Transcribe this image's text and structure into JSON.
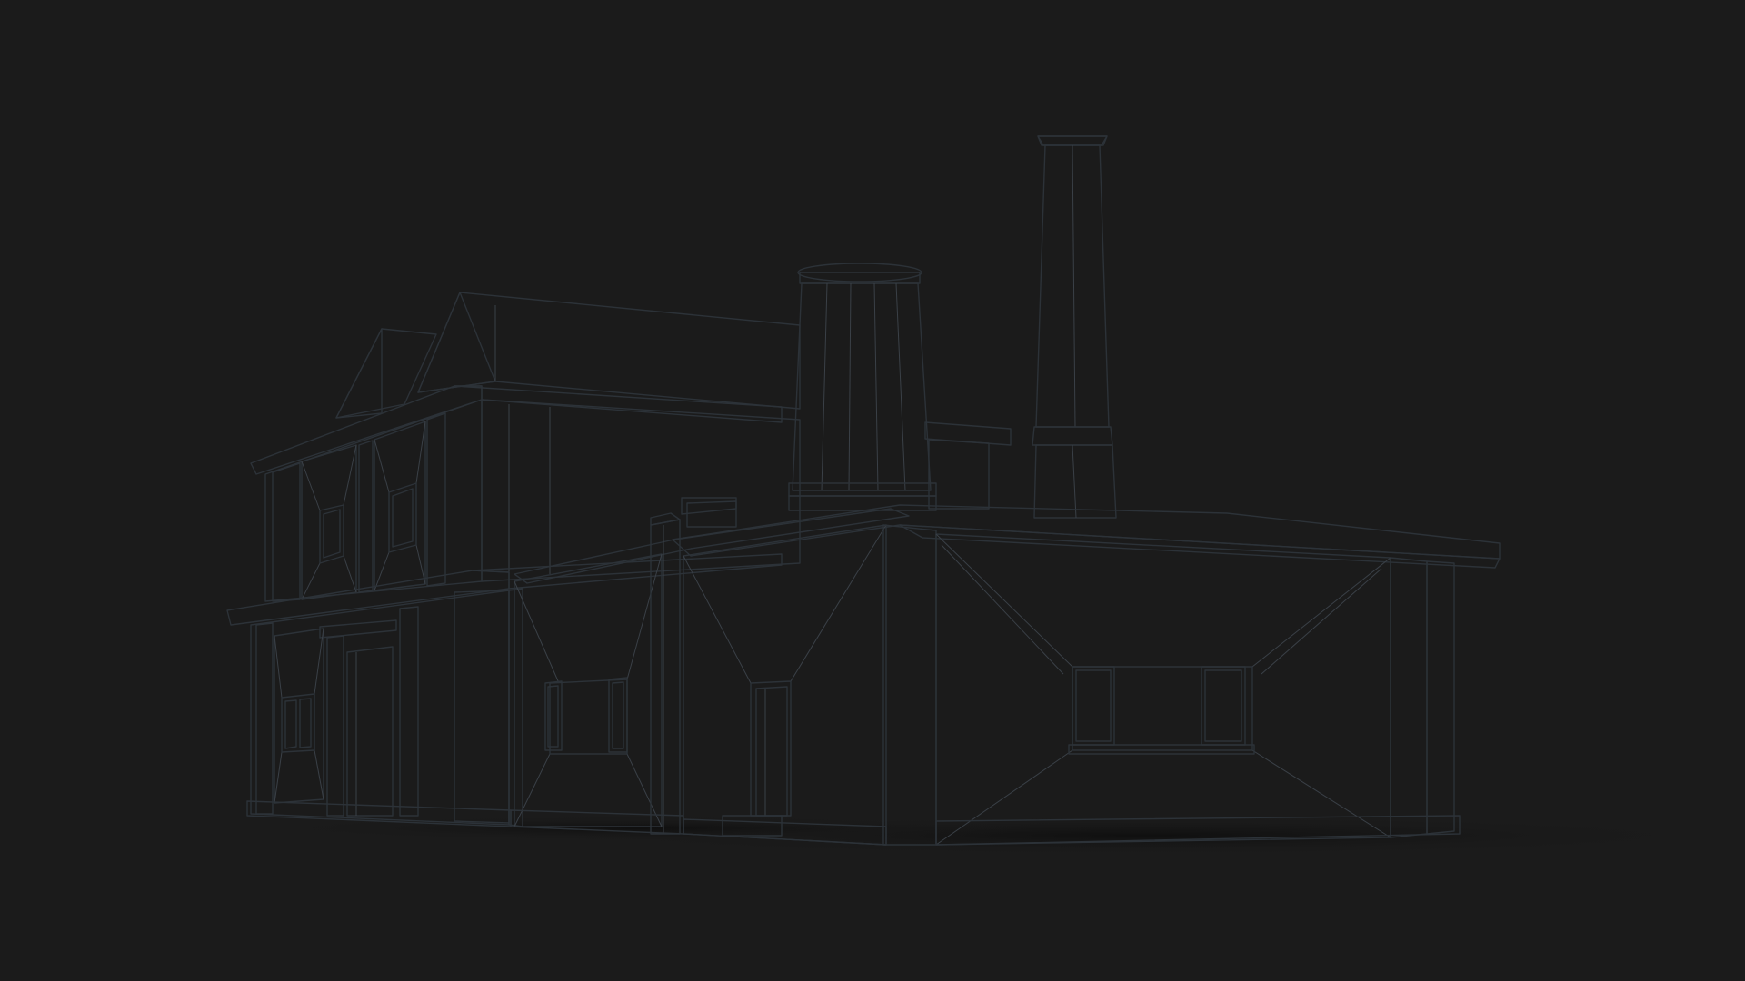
{
  "scene": {
    "background_color": "#1b1b1b",
    "model_base_color": "#8e969e",
    "model_light_color": "#a9b0b7",
    "model_shadow_color": "#5c646b",
    "wire_color": "#2c3238"
  }
}
